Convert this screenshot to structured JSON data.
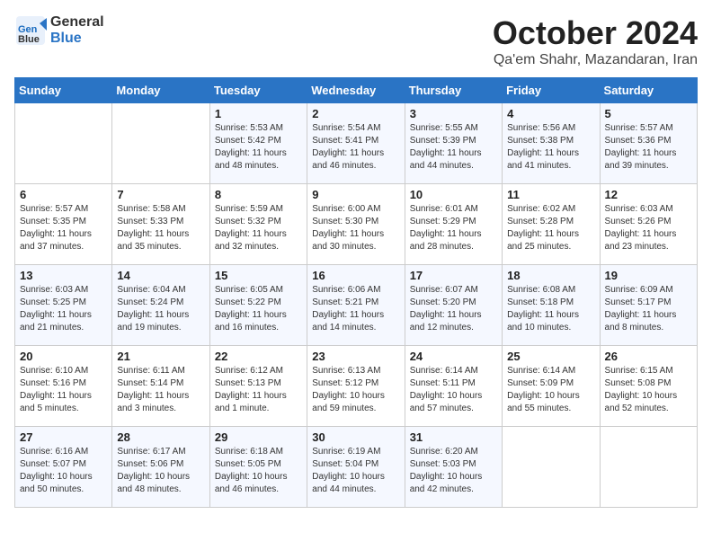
{
  "header": {
    "logo_line1": "General",
    "logo_line2": "Blue",
    "month": "October 2024",
    "location": "Qa'em Shahr, Mazandaran, Iran"
  },
  "weekdays": [
    "Sunday",
    "Monday",
    "Tuesday",
    "Wednesday",
    "Thursday",
    "Friday",
    "Saturday"
  ],
  "weeks": [
    [
      {
        "day": "",
        "info": ""
      },
      {
        "day": "",
        "info": ""
      },
      {
        "day": "1",
        "info": "Sunrise: 5:53 AM\nSunset: 5:42 PM\nDaylight: 11 hours and 48 minutes."
      },
      {
        "day": "2",
        "info": "Sunrise: 5:54 AM\nSunset: 5:41 PM\nDaylight: 11 hours and 46 minutes."
      },
      {
        "day": "3",
        "info": "Sunrise: 5:55 AM\nSunset: 5:39 PM\nDaylight: 11 hours and 44 minutes."
      },
      {
        "day": "4",
        "info": "Sunrise: 5:56 AM\nSunset: 5:38 PM\nDaylight: 11 hours and 41 minutes."
      },
      {
        "day": "5",
        "info": "Sunrise: 5:57 AM\nSunset: 5:36 PM\nDaylight: 11 hours and 39 minutes."
      }
    ],
    [
      {
        "day": "6",
        "info": "Sunrise: 5:57 AM\nSunset: 5:35 PM\nDaylight: 11 hours and 37 minutes."
      },
      {
        "day": "7",
        "info": "Sunrise: 5:58 AM\nSunset: 5:33 PM\nDaylight: 11 hours and 35 minutes."
      },
      {
        "day": "8",
        "info": "Sunrise: 5:59 AM\nSunset: 5:32 PM\nDaylight: 11 hours and 32 minutes."
      },
      {
        "day": "9",
        "info": "Sunrise: 6:00 AM\nSunset: 5:30 PM\nDaylight: 11 hours and 30 minutes."
      },
      {
        "day": "10",
        "info": "Sunrise: 6:01 AM\nSunset: 5:29 PM\nDaylight: 11 hours and 28 minutes."
      },
      {
        "day": "11",
        "info": "Sunrise: 6:02 AM\nSunset: 5:28 PM\nDaylight: 11 hours and 25 minutes."
      },
      {
        "day": "12",
        "info": "Sunrise: 6:03 AM\nSunset: 5:26 PM\nDaylight: 11 hours and 23 minutes."
      }
    ],
    [
      {
        "day": "13",
        "info": "Sunrise: 6:03 AM\nSunset: 5:25 PM\nDaylight: 11 hours and 21 minutes."
      },
      {
        "day": "14",
        "info": "Sunrise: 6:04 AM\nSunset: 5:24 PM\nDaylight: 11 hours and 19 minutes."
      },
      {
        "day": "15",
        "info": "Sunrise: 6:05 AM\nSunset: 5:22 PM\nDaylight: 11 hours and 16 minutes."
      },
      {
        "day": "16",
        "info": "Sunrise: 6:06 AM\nSunset: 5:21 PM\nDaylight: 11 hours and 14 minutes."
      },
      {
        "day": "17",
        "info": "Sunrise: 6:07 AM\nSunset: 5:20 PM\nDaylight: 11 hours and 12 minutes."
      },
      {
        "day": "18",
        "info": "Sunrise: 6:08 AM\nSunset: 5:18 PM\nDaylight: 11 hours and 10 minutes."
      },
      {
        "day": "19",
        "info": "Sunrise: 6:09 AM\nSunset: 5:17 PM\nDaylight: 11 hours and 8 minutes."
      }
    ],
    [
      {
        "day": "20",
        "info": "Sunrise: 6:10 AM\nSunset: 5:16 PM\nDaylight: 11 hours and 5 minutes."
      },
      {
        "day": "21",
        "info": "Sunrise: 6:11 AM\nSunset: 5:14 PM\nDaylight: 11 hours and 3 minutes."
      },
      {
        "day": "22",
        "info": "Sunrise: 6:12 AM\nSunset: 5:13 PM\nDaylight: 11 hours and 1 minute."
      },
      {
        "day": "23",
        "info": "Sunrise: 6:13 AM\nSunset: 5:12 PM\nDaylight: 10 hours and 59 minutes."
      },
      {
        "day": "24",
        "info": "Sunrise: 6:14 AM\nSunset: 5:11 PM\nDaylight: 10 hours and 57 minutes."
      },
      {
        "day": "25",
        "info": "Sunrise: 6:14 AM\nSunset: 5:09 PM\nDaylight: 10 hours and 55 minutes."
      },
      {
        "day": "26",
        "info": "Sunrise: 6:15 AM\nSunset: 5:08 PM\nDaylight: 10 hours and 52 minutes."
      }
    ],
    [
      {
        "day": "27",
        "info": "Sunrise: 6:16 AM\nSunset: 5:07 PM\nDaylight: 10 hours and 50 minutes."
      },
      {
        "day": "28",
        "info": "Sunrise: 6:17 AM\nSunset: 5:06 PM\nDaylight: 10 hours and 48 minutes."
      },
      {
        "day": "29",
        "info": "Sunrise: 6:18 AM\nSunset: 5:05 PM\nDaylight: 10 hours and 46 minutes."
      },
      {
        "day": "30",
        "info": "Sunrise: 6:19 AM\nSunset: 5:04 PM\nDaylight: 10 hours and 44 minutes."
      },
      {
        "day": "31",
        "info": "Sunrise: 6:20 AM\nSunset: 5:03 PM\nDaylight: 10 hours and 42 minutes."
      },
      {
        "day": "",
        "info": ""
      },
      {
        "day": "",
        "info": ""
      }
    ]
  ]
}
